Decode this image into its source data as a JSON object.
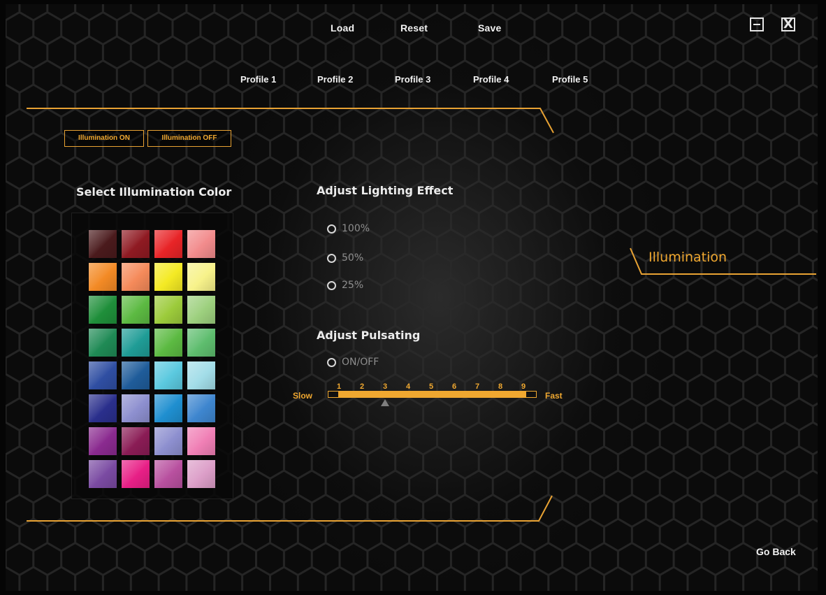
{
  "toolbar": {
    "load": "Load",
    "reset": "Reset",
    "save": "Save"
  },
  "window": {
    "minimize_icon": "minimize-icon",
    "close_icon": "close-icon",
    "close_glyph": "X"
  },
  "profiles": [
    "Profile 1",
    "Profile 2",
    "Profile 3",
    "Profile 4",
    "Profile 5"
  ],
  "illumination": {
    "on_label": "Illumination ON",
    "off_label": "Illumination OFF"
  },
  "color_section": {
    "heading": "Select Illumination Color",
    "swatches": [
      "#4a1a1c",
      "#8f1a22",
      "#e82427",
      "#f28b8c",
      "#f38a25",
      "#f58a5a",
      "#f4ea24",
      "#f7f28a",
      "#1f8f3a",
      "#5cba42",
      "#9ccb3b",
      "#9dd07e",
      "#1f8a55",
      "#1f9c96",
      "#5cba42",
      "#5ebd6e",
      "#2f4ea2",
      "#1f5c9a",
      "#5bc9df",
      "#a2dde8",
      "#2a2f8c",
      "#8d8fcf",
      "#1f8fd0",
      "#3e86cf",
      "#8a2a8f",
      "#8a1c55",
      "#8d8fcf",
      "#f07fb5",
      "#7a4aa2",
      "#e81f86",
      "#b8509f",
      "#dc9ec8"
    ]
  },
  "lighting": {
    "heading": "Adjust Lighting Effect",
    "options": [
      "100%",
      "50%",
      "25%"
    ]
  },
  "pulsating": {
    "heading": "Adjust Pulsating",
    "toggle_label": "ON/OFF",
    "slow_label": "Slow",
    "fast_label": "Fast",
    "ticks": [
      "1",
      "2",
      "3",
      "4",
      "5",
      "6",
      "7",
      "8",
      "9"
    ],
    "value": 3
  },
  "side_tab": {
    "title": "Illumination"
  },
  "footer": {
    "go_back": "Go Back"
  },
  "colors": {
    "accent": "#f0a830",
    "background": "#0b0b0b"
  }
}
